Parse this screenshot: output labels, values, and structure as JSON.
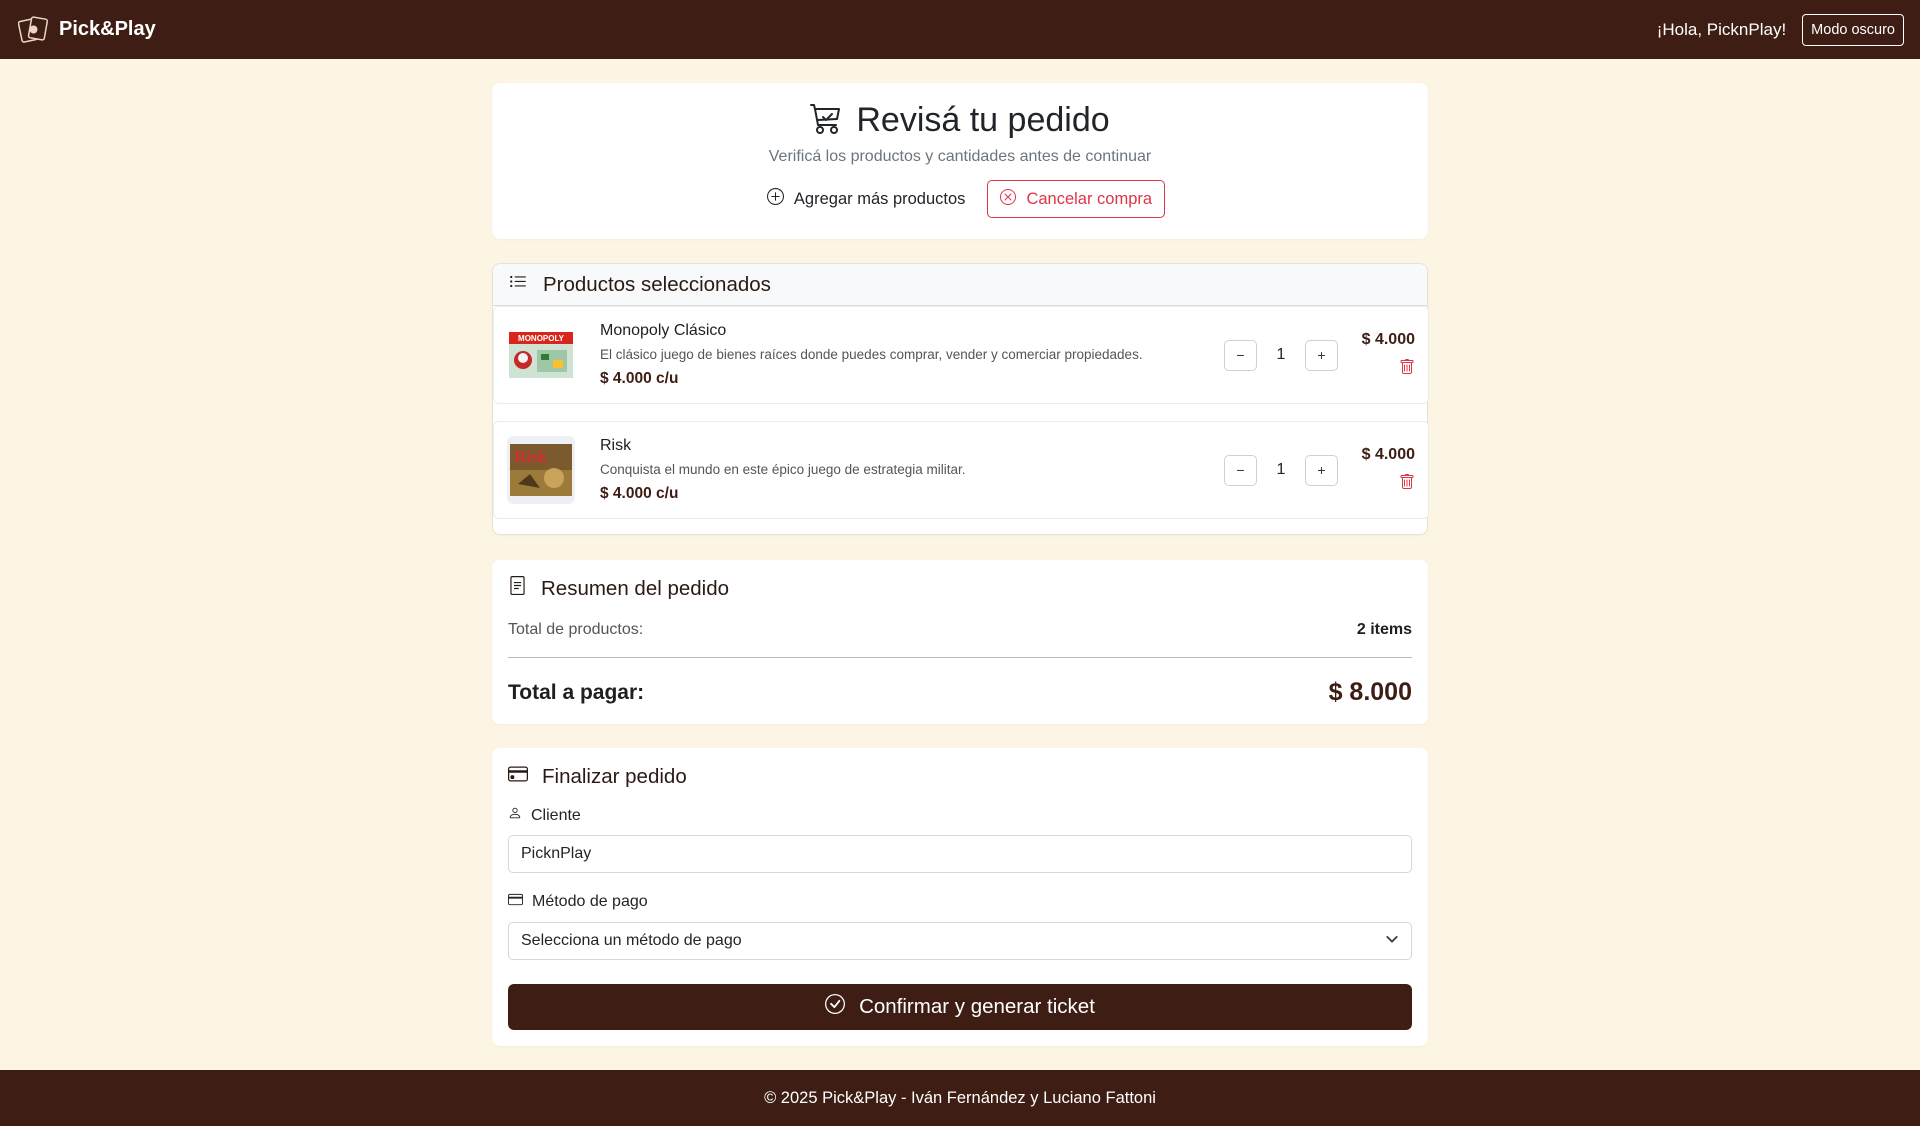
{
  "navbar": {
    "brand": "Pick&Play",
    "greeting": "¡Hola, PicknPlay!",
    "dark_mode_label": "Modo oscuro",
    "color": "#3d1d14"
  },
  "header": {
    "title": "Revisá tu pedido",
    "subtitle": "Verificá los productos y cantidades antes de continuar",
    "add_more_label": "Agregar más productos",
    "cancel_label": "Cancelar compra"
  },
  "products": {
    "title": "Productos seleccionados",
    "items": [
      {
        "name": "Monopoly Clásico",
        "description": "El clásico juego de bienes raíces donde puedes comprar, vender y comerciar propiedades.",
        "unit_price": "$ 4.000 c/u",
        "quantity": "1",
        "total": "$ 4.000",
        "image_text": "MONOPOLY",
        "minus": "−",
        "plus": "+"
      },
      {
        "name": "Risk",
        "description": "Conquista el mundo en este épico juego de estrategia militar.",
        "unit_price": "$ 4.000 c/u",
        "quantity": "1",
        "total": "$ 4.000",
        "image_text": "Risk",
        "minus": "−",
        "plus": "+"
      }
    ]
  },
  "summary": {
    "title": "Resumen del pedido",
    "items_label": "Total de productos:",
    "items_value": "2 items",
    "total_label": "Total a pagar:",
    "total_value": "$ 8.000"
  },
  "finalize": {
    "title": "Finalizar pedido",
    "client_label": "Cliente",
    "client_value": "PicknPlay",
    "payment_label": "Método de pago",
    "payment_selected": "Selecciona un método de pago",
    "confirm_label": "Confirmar y generar ticket"
  },
  "footer": {
    "text": "© 2025 Pick&Play - Iván Fernández y Luciano Fattoni"
  }
}
